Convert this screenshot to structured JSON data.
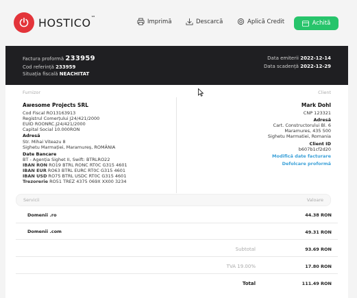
{
  "brand": {
    "name": "HOSTICO",
    "tm": "™",
    "accent": "#e3343a"
  },
  "toolbar": {
    "print_label": "Imprimă",
    "download_label": "Descarcă",
    "credit_label": "Aplică Credit",
    "pay_label": "Achită",
    "pay_color": "#27c46b"
  },
  "invoice": {
    "proforma_label": "Factura proformă",
    "proforma_number": "233959",
    "ref_label": "Cod referință",
    "ref_number": "233959",
    "fiscal_label": "Situația fiscală",
    "fiscal_status": "NEACHITAT",
    "issue_label": "Data emiterii",
    "issue_date": "2022-12-14",
    "due_label": "Data scadență",
    "due_date": "2022-12-29"
  },
  "supplier": {
    "label": "Furnizor",
    "name": "Awesome Projects SRL",
    "lines": [
      "Cod Fiscal RO13163913",
      "Registrul Comerțului J24/421/2000",
      "EUID ROONRC.J24/421/2000",
      "Capital Social 10.000RON"
    ],
    "address_label": "Adresă",
    "address_lines": [
      "Str. Mihai Viteazu 8",
      "Sighetu Marmației, Maramureș, ROMÂNIA"
    ],
    "bank_label": "Date Bancare",
    "bank_line": "BT - Agenția Sighet II, Swift: BTRLRO22",
    "ibans": [
      {
        "label": "IBAN RON",
        "value": "RO19 BTRL RONC RT0C G315 4601"
      },
      {
        "label": "IBAN EUR",
        "value": "RO63 BTRL EURC RT0C G315 4601"
      },
      {
        "label": "IBAN USD",
        "value": "RO75 BTRL USDC RT0C G315 4601"
      },
      {
        "label": "Trezorerie",
        "value": "RO51 TREZ 4375 069X XX00 3234"
      }
    ]
  },
  "client": {
    "label": "Client",
    "name": "Mark Dohl",
    "cnp": "CNP 123321",
    "address_label": "Adresă",
    "address_lines": [
      "Cart. Constructorului Bl. 6",
      "Maramures, 435 500",
      "Sighetu Marmatiei, Romania"
    ],
    "id_label": "Client ID",
    "id_value": "b607b1cf2d20",
    "edit_link": "Modifică date facturare",
    "default_link": "Defolcare proformă"
  },
  "services": {
    "col_service": "Servicii",
    "col_value": "Valoare",
    "rows": [
      {
        "name": "Domenii .ro",
        "value": "44.38 RON"
      },
      {
        "name": "Domenii .com",
        "value": "49.31 RON"
      }
    ],
    "subtotal_label": "Subtotal",
    "subtotal_value": "93.69 RON",
    "vat_label": "TVA 19.00%",
    "vat_value": "17.80 RON",
    "total_label": "Total",
    "total_value": "111.49 RON"
  }
}
